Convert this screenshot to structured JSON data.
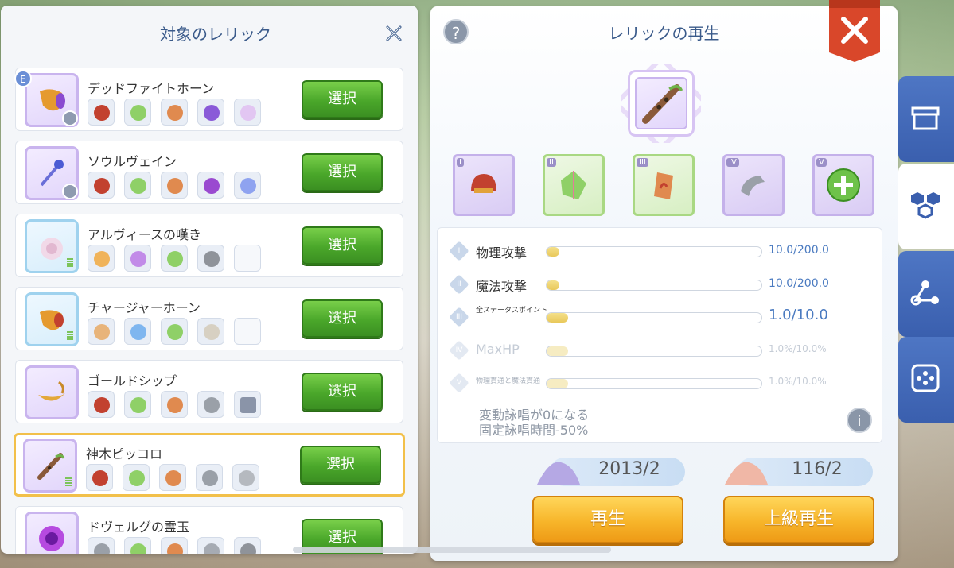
{
  "left_panel": {
    "title": "対象のレリック",
    "items": [
      {
        "name": "デッドファイトホーン",
        "select_label": "選択",
        "badge": "E",
        "selected": false
      },
      {
        "name": "ソウルヴェイン",
        "select_label": "選択",
        "selected": false
      },
      {
        "name": "アルヴィースの嘆き",
        "select_label": "選択",
        "selected": false
      },
      {
        "name": "チャージャーホーン",
        "select_label": "選択",
        "selected": false
      },
      {
        "name": "ゴールドシップ",
        "select_label": "選択",
        "selected": false
      },
      {
        "name": "神木ピッコロ",
        "select_label": "選択",
        "selected": true
      },
      {
        "name": "ドヴェルグの霊玉",
        "select_label": "選択",
        "selected": false
      }
    ]
  },
  "right_panel": {
    "title": "レリックの再生",
    "help": "?",
    "slots": [
      {
        "num": "I",
        "icon": "red-helmet-icon"
      },
      {
        "num": "II",
        "icon": "green-crystal-icon"
      },
      {
        "num": "III",
        "icon": "orange-stone-icon"
      },
      {
        "num": "IV",
        "icon": "gray-horn-icon"
      },
      {
        "num": "V",
        "icon": "add-icon"
      }
    ],
    "stats": [
      {
        "num": "I",
        "label": "物理攻撃",
        "value": "10.0/200.0",
        "fill": 0.05,
        "dim": false
      },
      {
        "num": "II",
        "label": "魔法攻撃",
        "value": "10.0/200.0",
        "fill": 0.05,
        "dim": false
      },
      {
        "num": "III",
        "label": "全ステータスポイント",
        "value": "1.0/10.0",
        "fill": 0.1,
        "dim": false
      },
      {
        "num": "IV",
        "label": "MaxHP",
        "value": "1.0%/10.0%",
        "fill": 0.1,
        "dim": true
      },
      {
        "num": "V",
        "label": "物理貫通と魔法貫通",
        "value": "1.0%/10.0%",
        "fill": 0.1,
        "dim": true
      }
    ],
    "effect_line1": "変動詠唱が0になる",
    "effect_line2": "固定詠唱時間-50%",
    "info": "i",
    "costs": [
      {
        "text": "2013/2"
      },
      {
        "text": "116/2"
      }
    ],
    "regen_label": "再生",
    "adv_regen_label": "上級再生"
  },
  "colors": {
    "title_blue": "#3a5a8a",
    "select_green": "#4aa72a",
    "action_orange": "#f7b52a",
    "close_red": "#d9472a",
    "tab_blue": "#3a5fae"
  }
}
